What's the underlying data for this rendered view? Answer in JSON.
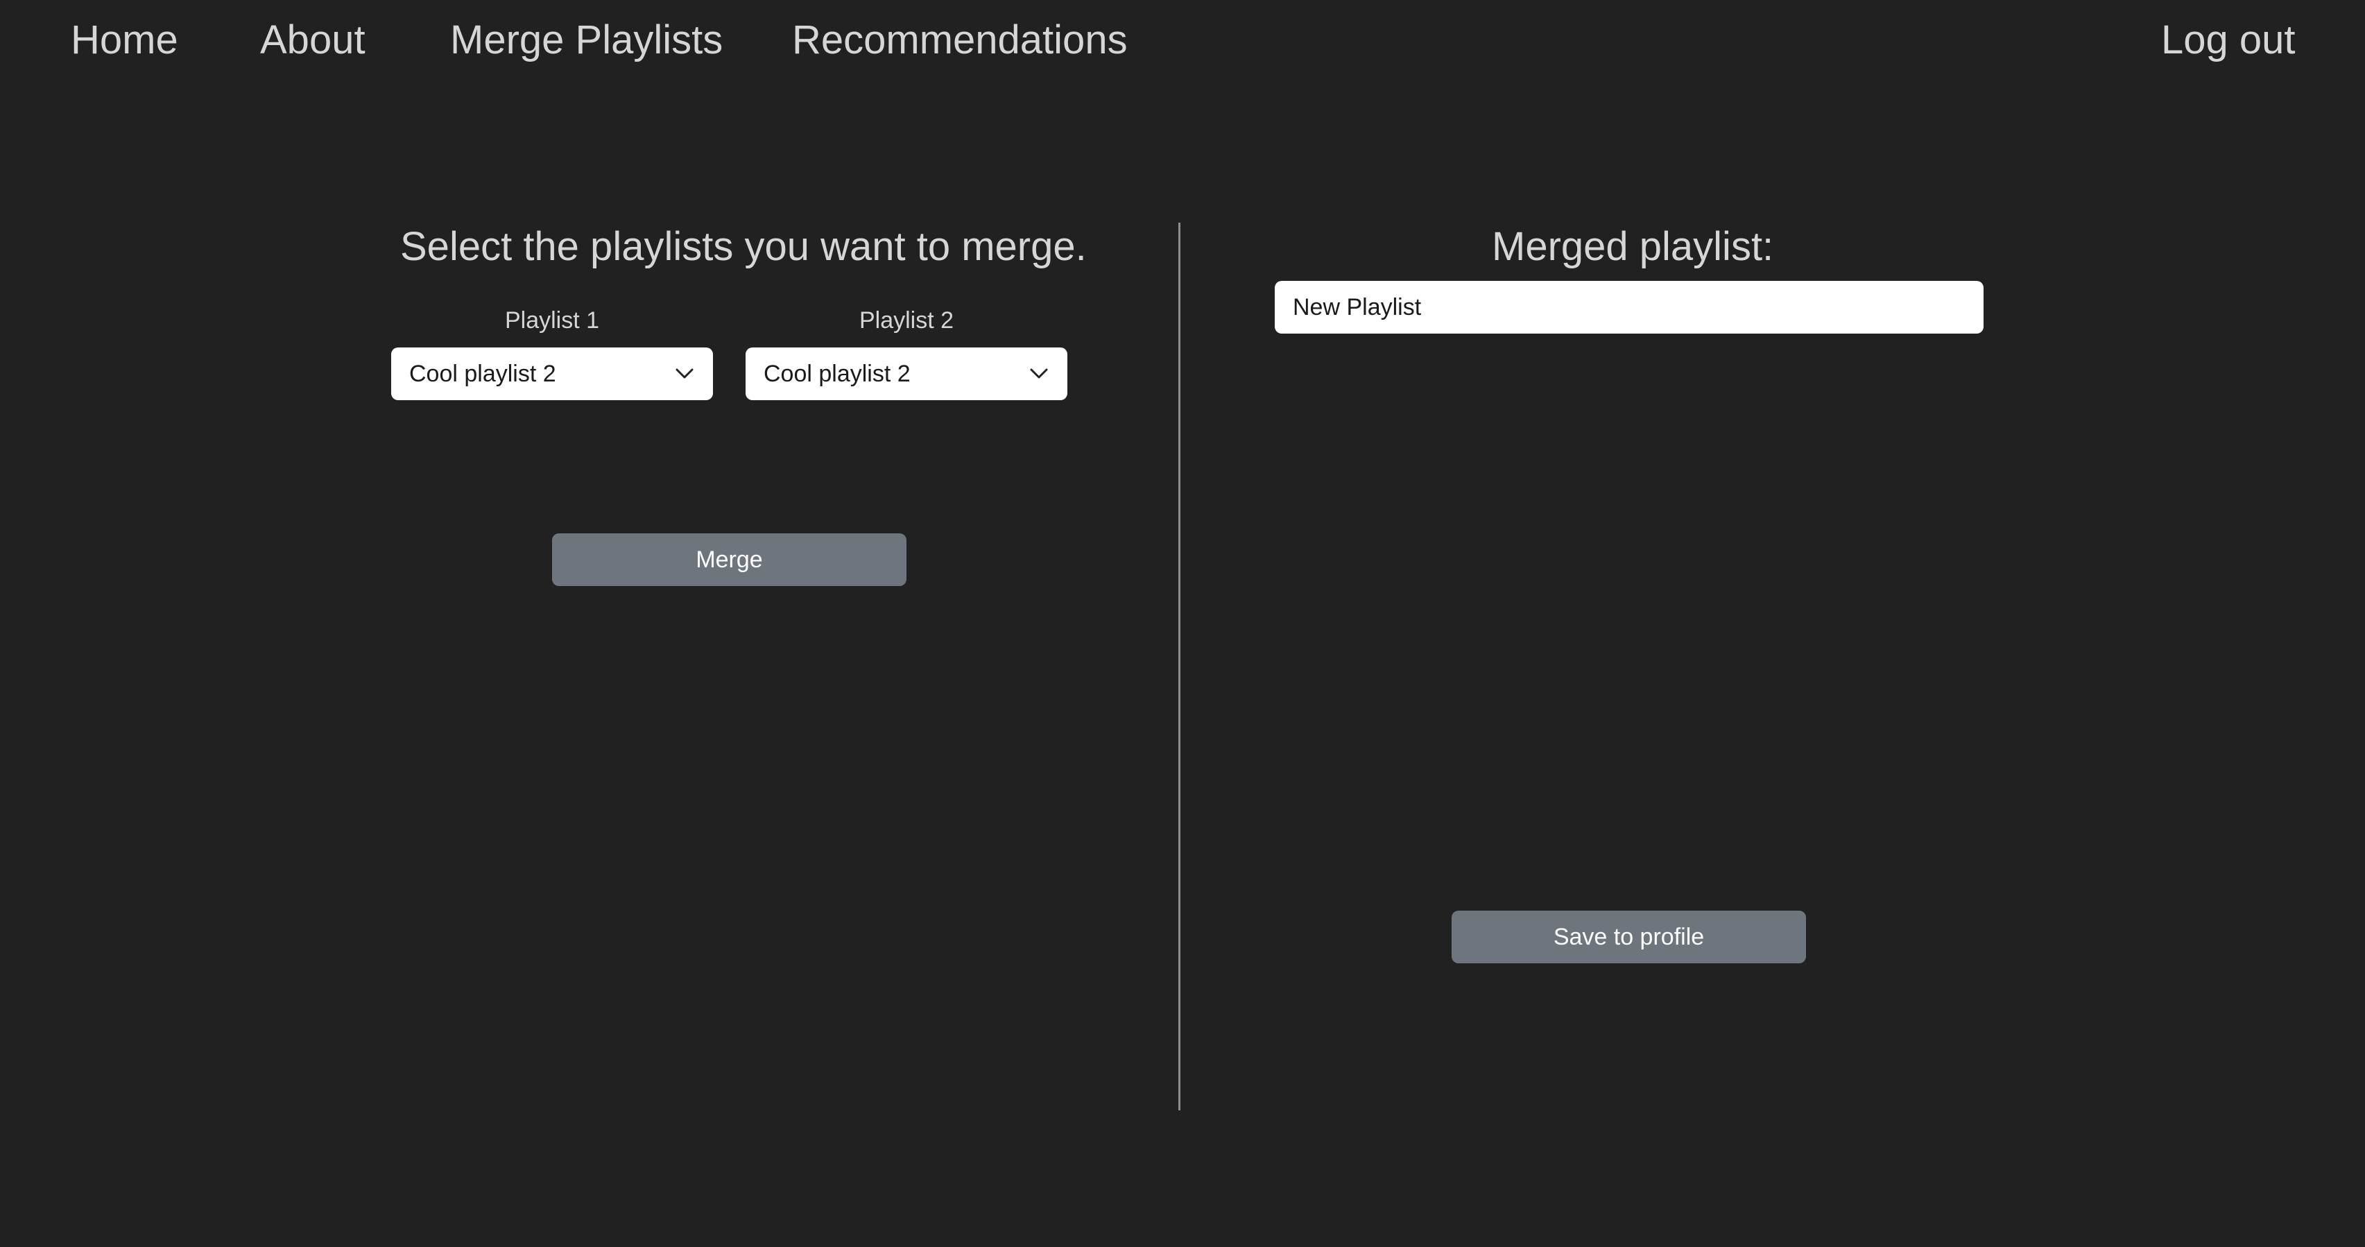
{
  "nav": {
    "items": [
      {
        "label": "Home"
      },
      {
        "label": "About"
      },
      {
        "label": "Merge Playlists"
      },
      {
        "label": "Recommendations"
      }
    ],
    "logout_label": "Log out"
  },
  "merge_panel": {
    "title": "Select the playlists you want to merge.",
    "playlist1": {
      "label": "Playlist 1",
      "selected": "Cool playlist 2"
    },
    "playlist2": {
      "label": "Playlist 2",
      "selected": "Cool playlist 2"
    },
    "merge_button_label": "Merge"
  },
  "result_panel": {
    "title": "Merged playlist:",
    "name_value": "New Playlist",
    "save_button_label": "Save to profile"
  },
  "icons": {
    "dropdown": "chevron-down-icon"
  },
  "colors": {
    "background": "#212121",
    "button": "#6f757c",
    "text": "#d6d6d6",
    "divider": "#8e8e8e"
  }
}
